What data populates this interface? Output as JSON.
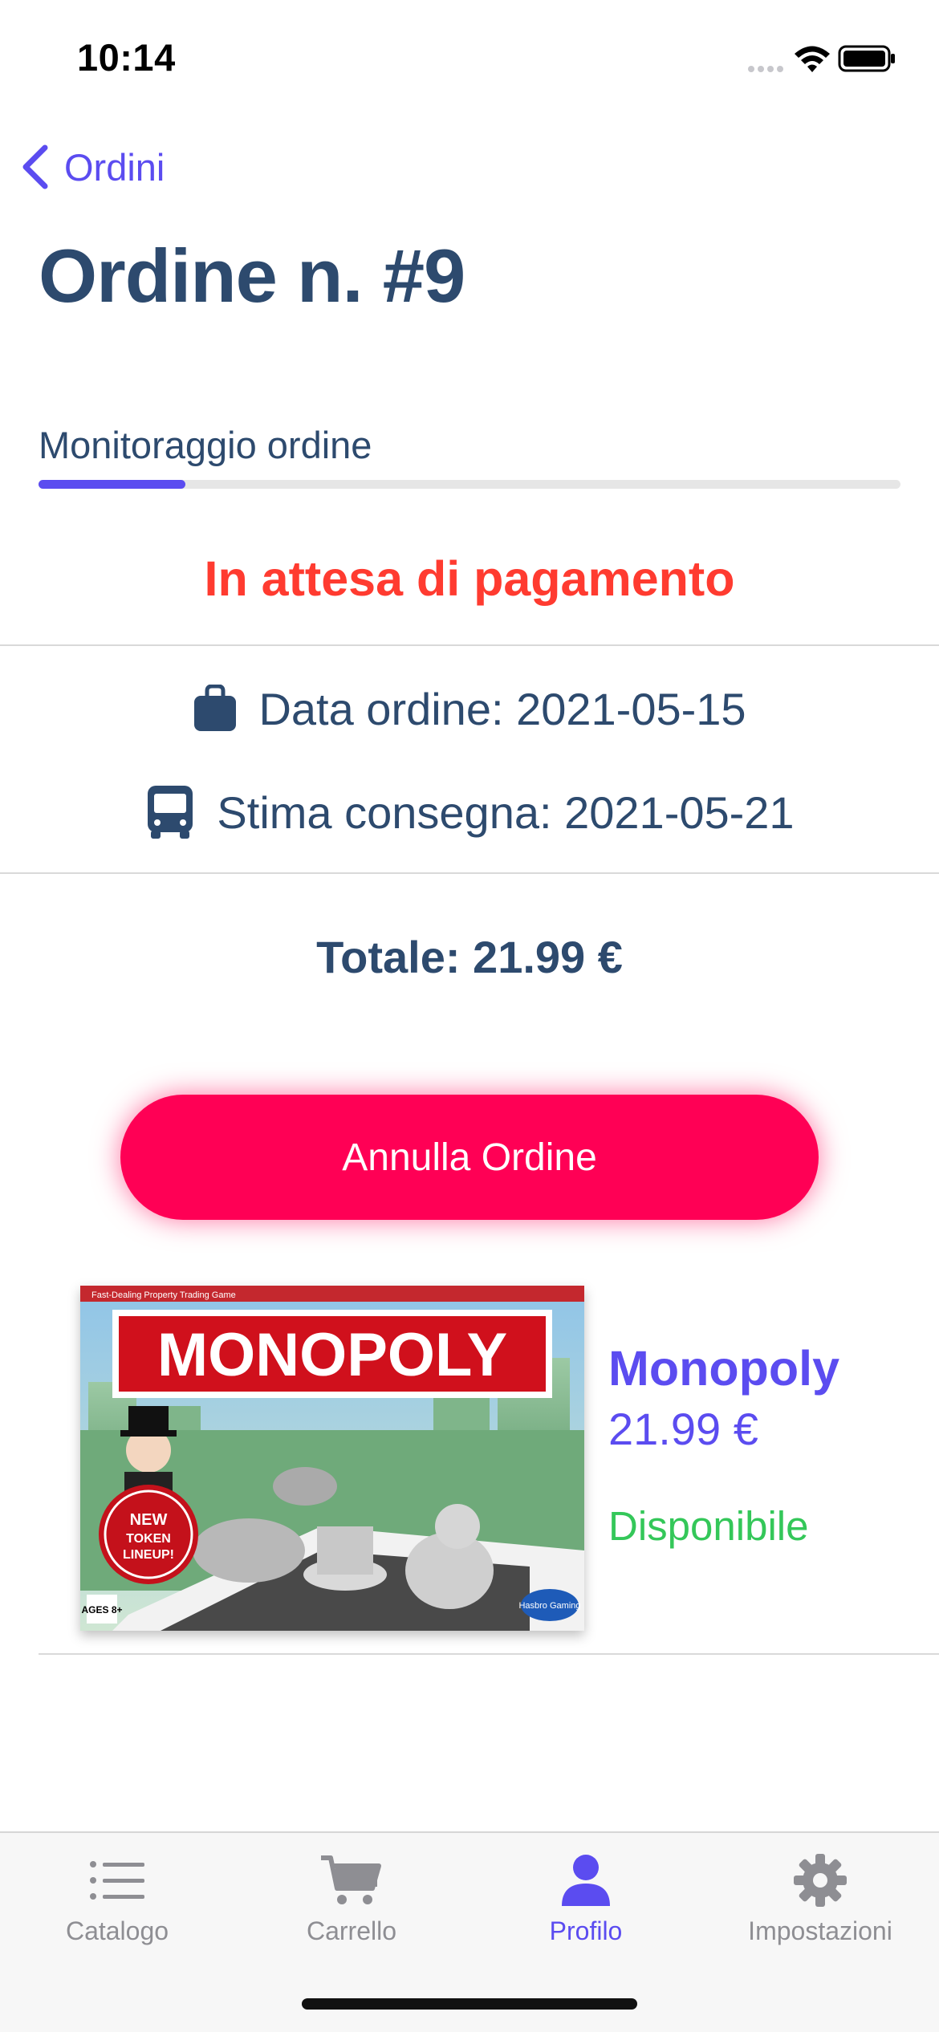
{
  "status_bar": {
    "time": "10:14"
  },
  "nav": {
    "back_label": "Ordini"
  },
  "page": {
    "title": "Ordine n. #9"
  },
  "tracking": {
    "label": "Monitoraggio ordine",
    "progress": 0.17
  },
  "order": {
    "status": "In attesa di pagamento",
    "order_date": "Data ordine: 2021-05-15",
    "delivery_estimate": "Stima consegna: 2021-05-21",
    "total": "Totale: 21.99 €",
    "cancel_label": "Annulla Ordine"
  },
  "items": [
    {
      "name": "Monopoly",
      "price": "21.99 €",
      "availability": "Disponibile",
      "image_text": {
        "brand": "MONOPOLY",
        "top_banner": "Fast-Dealing Property Trading Game",
        "badge": "NEW TOKEN LINEUP!",
        "maker": "Hasbro Gaming",
        "age": "AGES 8+"
      }
    }
  ],
  "tab_bar": {
    "tabs": [
      {
        "label": "Catalogo",
        "icon": "list-icon"
      },
      {
        "label": "Carrello",
        "icon": "cart-icon"
      },
      {
        "label": "Profilo",
        "icon": "person-icon"
      },
      {
        "label": "Impostazioni",
        "icon": "gear-icon"
      }
    ],
    "active_tab": "Profilo"
  },
  "colors": {
    "accent": "#5b4cf0",
    "title": "#2d4a6e",
    "status_red": "#ff3b30",
    "button_pink": "#ff0055",
    "available_green": "#34c759"
  }
}
